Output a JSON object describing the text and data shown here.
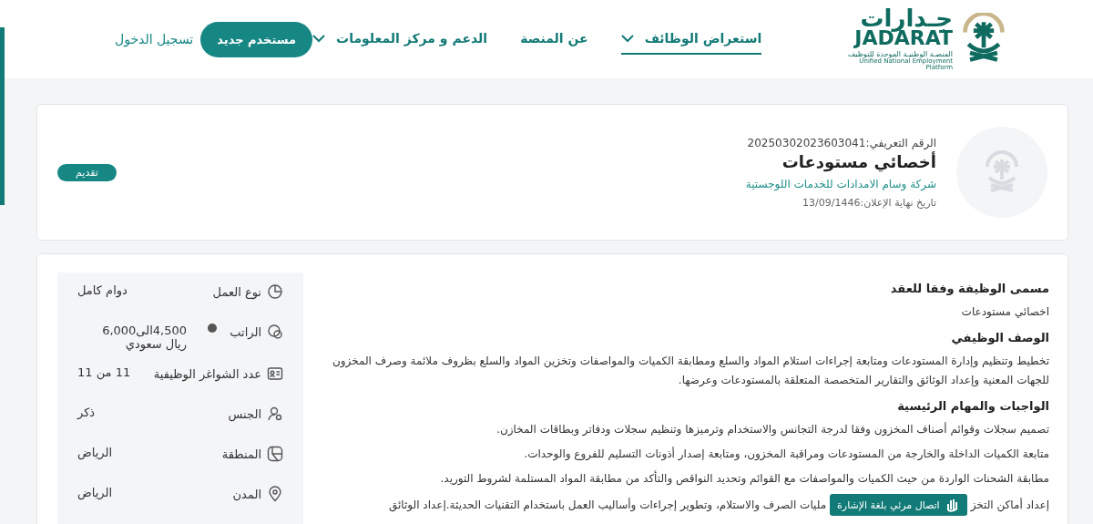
{
  "header": {
    "logo": {
      "arabic": "جـدارات",
      "latin": "JADARAT",
      "tagline_ar": "المنصـة الوطنيـة الموحدة للتوظيف",
      "tagline_en": "Unified National Employment Platform"
    },
    "nav": [
      {
        "label": "استعراض الوظائف",
        "dropdown": true,
        "selected": true
      },
      {
        "label": "عن المنصة",
        "dropdown": false,
        "selected": false
      },
      {
        "label": "الدعم و مركز المعلومات",
        "dropdown": true,
        "selected": false
      }
    ],
    "register_button": "مستخدم جديد",
    "login_link": "تسجيل الدخول"
  },
  "job": {
    "id_label": "الرقم التعريفي:",
    "id": "20250302023603041",
    "title": "أخصائي مستودعات",
    "company": "شركة وسام الامدادات للخدمات اللوجستية",
    "deadline_label": "تاريخ نهاية الإعلان:",
    "deadline": "13/09/1446",
    "apply_button": "تقديم"
  },
  "sections": [
    {
      "heading": "مسمى الوظيفة وفقا للعقد",
      "lines": [
        "اخصائي مستودعات"
      ]
    },
    {
      "heading": "الوصف الوظيفي",
      "lines": [
        "تخطيط وتنظيم وإدارة المستودعات ومتابعة إجراءات استلام المواد والسلع ومطابقة الكميات والمواصفات وتخزين المواد والسلع بظروف ملائمة وصرف المخزون للجهات المعنية وإعداد الوثائق والتقارير المتخصصة المتعلقة بالمستودعات وعرضها."
      ]
    },
    {
      "heading": "الواجبات والمهام الرئيسية",
      "lines": [
        "تصميم سجلات وقوائم أصناف المخزون وفقا لدرجة التجانس والاستخدام وترميزها وتنظيم سجلات ودفاتر وبطاقات المخازن.",
        "متابعة الكميات الداخلة والخارجة من المستودعات ومراقبة المخزون، ومتابعة إصدار أذونات التسليم للفروع والوحدات.",
        "مطابقة الشحنات الواردة من حيث الكميات والمواصفات مع القوائم وتحديد النواقص والتأكد من مطابقة المواد المستلمة لشروط التوريد."
      ],
      "covered_line": [
        "إعداد أماكن التخز",
        "مليات الصرف والاستلام، وتطوير إجراءات وأساليب العمل باستخدام التقنيات الحديثة.إعداد الوثائق"
      ]
    }
  ],
  "details": [
    {
      "kind": "clock",
      "label": "نوع العمل",
      "value": "دوام كامل",
      "info": false
    },
    {
      "kind": "money",
      "label": "الراتب",
      "value": "4,500الى6,000 ريال سعودي",
      "info": true
    },
    {
      "kind": "card",
      "label": "عدد الشواغر الوظيفية",
      "value": "11 من 11",
      "info": false
    },
    {
      "kind": "person",
      "label": "الجنس",
      "value": "ذكر",
      "info": false
    },
    {
      "kind": "map",
      "label": "المنطقة",
      "value": "الرياض",
      "info": false
    },
    {
      "kind": "pin",
      "label": "المدن",
      "value": "الرياض",
      "info": false
    }
  ],
  "sign_language_button": "اتصال مرئي بلغة الإشارة"
}
